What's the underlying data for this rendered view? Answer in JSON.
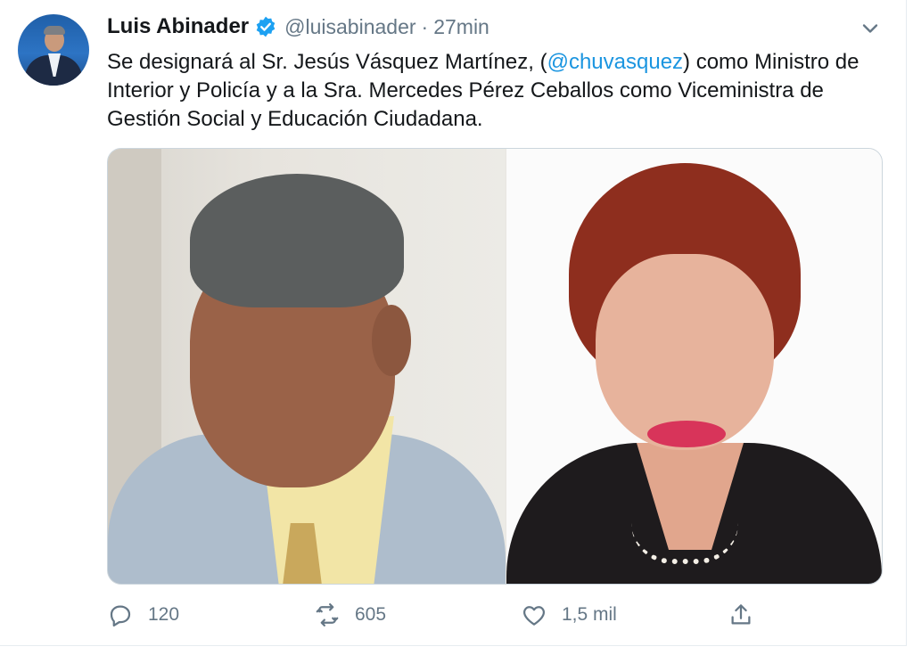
{
  "tweet": {
    "author": {
      "name": "Luis Abinader",
      "handle": "@luisabinader",
      "separator": "·",
      "time": "27min"
    },
    "text": {
      "part1": "Se designará al Sr. Jesús Vásquez Martínez, (",
      "mention": "@chuvasquez",
      "part2": ") como Ministro de Interior y Policía y a la Sra. Mercedes Pérez Ceballos como Viceministra de Gestión Social y Educación Ciudadana."
    },
    "actions": {
      "reply_count": "120",
      "retweet_count": "605",
      "like_count": "1,5 mil"
    }
  },
  "icons": {
    "verified": "verified-badge-icon",
    "caret": "chevron-down-icon",
    "reply": "reply-icon",
    "retweet": "retweet-icon",
    "like": "heart-icon",
    "share": "share-icon"
  },
  "colors": {
    "verified": "#1da1f2",
    "mention": "#1b95e0",
    "secondary_text": "#657786"
  }
}
